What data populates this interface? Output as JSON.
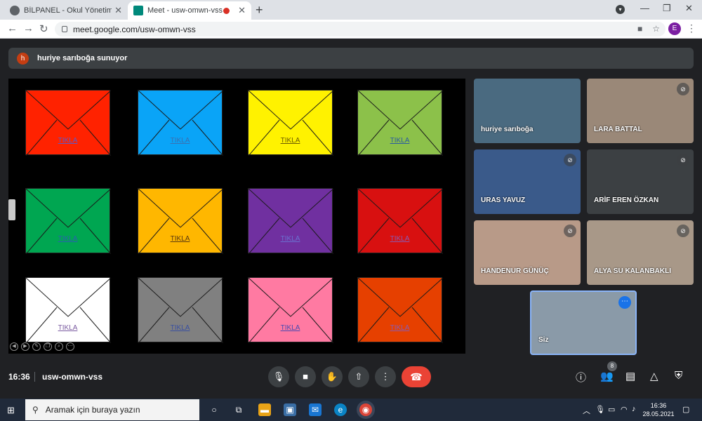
{
  "browser": {
    "tabs": [
      {
        "title": "BİLPANEL - Okul Yönetim Sistemi",
        "favicon_color": "#5f6368"
      },
      {
        "title": "Meet - usw-omwn-vss",
        "favicon_color": "#00897b"
      }
    ],
    "url": "meet.google.com/usw-omwn-vss",
    "profile_initial": "E"
  },
  "meet": {
    "presenter": {
      "initial": "h",
      "text": "huriye sarıboğa sunuyor"
    },
    "envelopes": [
      {
        "color": "#ff2200",
        "label": "TIKLA",
        "label_color": "#5a5acc"
      },
      {
        "color": "#0aa4f7",
        "label": "TIKLA",
        "label_color": "#3a70b0"
      },
      {
        "color": "#fff200",
        "label": "TIKLA",
        "label_color": "#6a5a00"
      },
      {
        "color": "#8cc14a",
        "label": "TIKLA",
        "label_color": "#2a5aa0"
      },
      {
        "color": "#00a651",
        "label": "TIKLA",
        "label_color": "#2a60b0"
      },
      {
        "color": "#ffb700",
        "label": "TIKLA",
        "label_color": "#5a3a10"
      },
      {
        "color": "#7030a0",
        "label": "TIKLA",
        "label_color": "#6a70d0"
      },
      {
        "color": "#d81010",
        "label": "TIKLA",
        "label_color": "#8a5ab0"
      },
      {
        "color": "#ffffff",
        "label": "TIKLA",
        "label_color": "#7a5aa0"
      },
      {
        "color": "#808080",
        "label": "TIKLA",
        "label_color": "#3a50a0"
      },
      {
        "color": "#ff7aa2",
        "label": "TIKLA",
        "label_color": "#4a4ab0"
      },
      {
        "color": "#e64000",
        "label": "TIKLA",
        "label_color": "#8a5ab0"
      }
    ],
    "participants": [
      {
        "name": "huriye sarıboğa",
        "bg": "#4a6a80",
        "muted": false
      },
      {
        "name": "LARA BATTAL",
        "bg": "#9a8878",
        "muted": true
      },
      {
        "name": "URAS YAVUZ",
        "bg": "#3a5a8a",
        "muted": true
      },
      {
        "name": "ARİF EREN ÖZKAN",
        "bg": "#3c4043",
        "muted": true
      },
      {
        "name": "HANDENUR GÜNÜÇ",
        "bg": "#b89a88",
        "muted": true
      },
      {
        "name": "ALYA SU KALANBAKLI",
        "bg": "#a89888",
        "muted": true
      }
    ],
    "self": {
      "name": "Siz",
      "bg": "#8a9aa8"
    },
    "time": "16:36",
    "meeting_code": "usw-omwn-vss",
    "participant_count": "8"
  },
  "taskbar": {
    "search_placeholder": "Aramak için buraya yazın",
    "time": "16:36",
    "date": "28.05.2021"
  }
}
